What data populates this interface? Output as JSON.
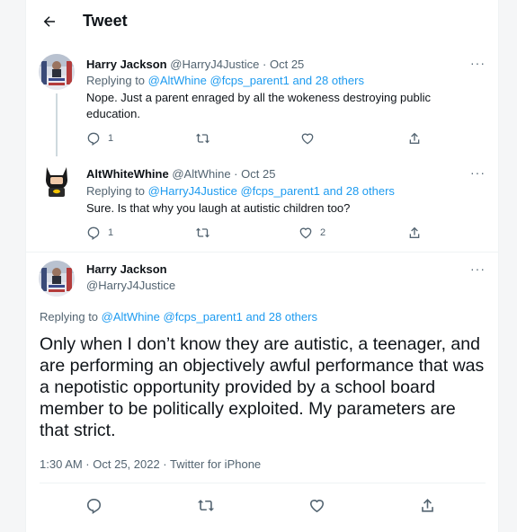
{
  "header": {
    "title": "Tweet"
  },
  "tweets": [
    {
      "name": "Harry Jackson",
      "handle": "@HarryJ4Justice",
      "date": "Oct 25",
      "replying_label": "Replying to",
      "replying_targets": "@AltWhine @fcps_parent1 and 28 others",
      "text": "Nope. Just a parent enraged by all the wokeness destroying public education.",
      "reply_count": "1",
      "retweet_count": "",
      "like_count": ""
    },
    {
      "name": "AltWhiteWhine",
      "handle": "@AltWhine",
      "date": "Oct 25",
      "replying_label": "Replying to",
      "replying_targets": "@HarryJ4Justice @fcps_parent1 and 28 others",
      "text": "Sure. Is that why you laugh at autistic children too?",
      "reply_count": "1",
      "retweet_count": "",
      "like_count": "2"
    }
  ],
  "main_tweet": {
    "name": "Harry Jackson",
    "handle": "@HarryJ4Justice",
    "replying_label": "Replying to",
    "replying_targets": "@AltWhine @fcps_parent1 and 28 others",
    "text": "Only when I don’t know they are autistic, a teenager, and are performing an objectively awful performance that was a nepotistic opportunity provided by a school board member to be politically exploited. My parameters are that strict.",
    "timestamp": "1:30 AM · Oct 25, 2022 · Twitter for iPhone"
  },
  "separators": {
    "dot": " · ",
    "more": "···"
  },
  "colors": {
    "accent": "#1d9bf0",
    "secondary_text": "#536471",
    "primary_text": "#0f1419"
  },
  "icons": [
    "back-arrow-icon",
    "reply-icon",
    "retweet-icon",
    "like-icon",
    "share-icon",
    "more-icon"
  ]
}
